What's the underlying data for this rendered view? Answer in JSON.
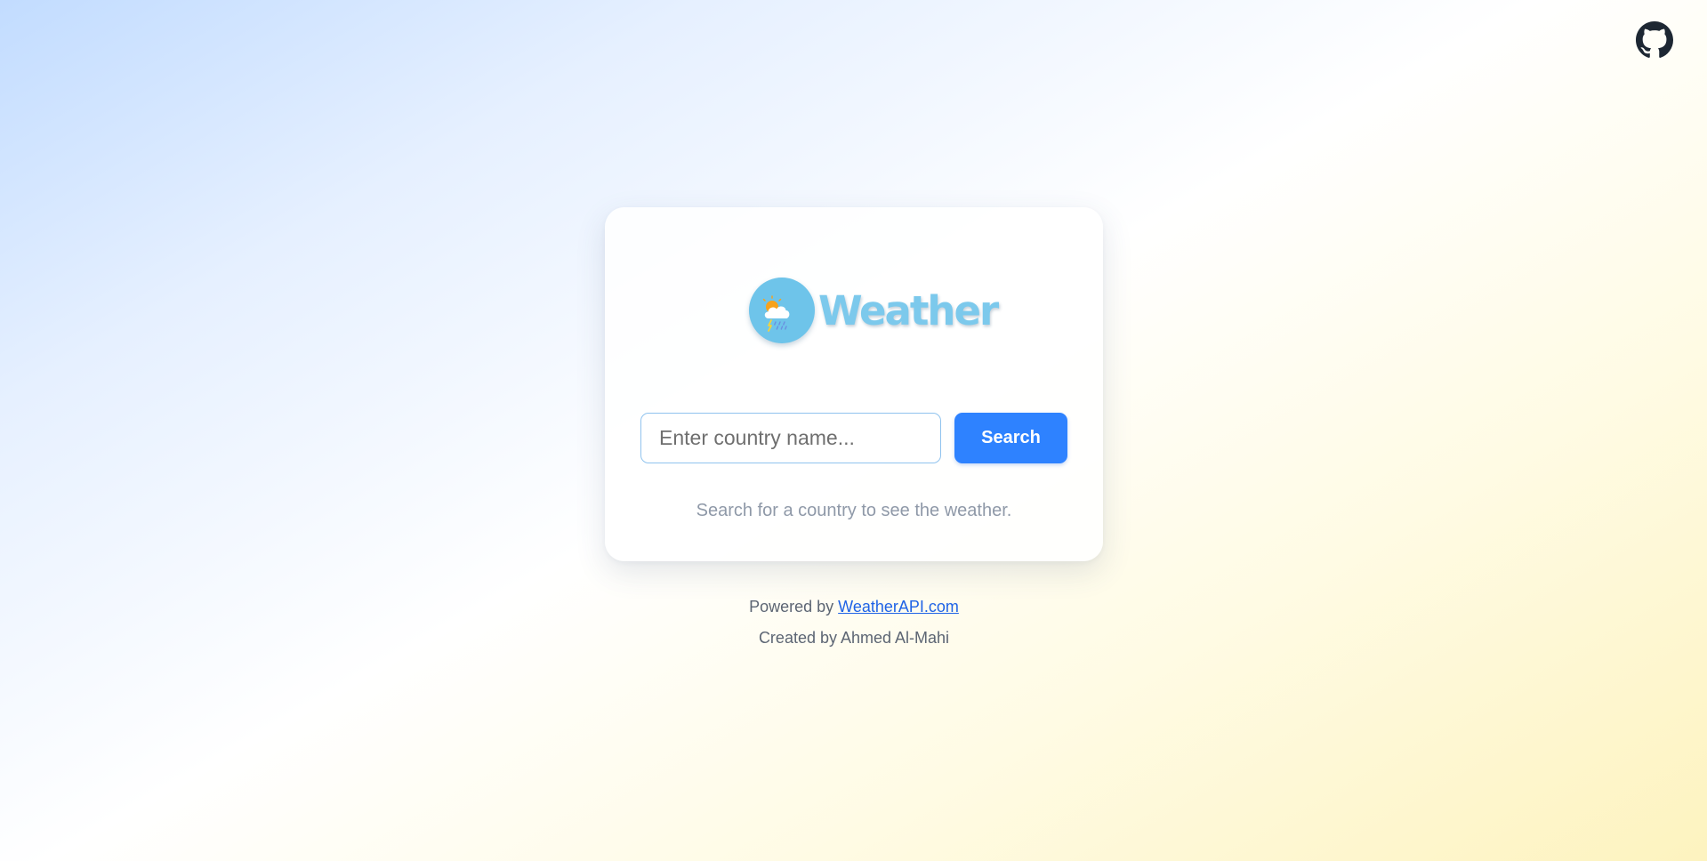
{
  "header": {
    "github_icon": "github-icon"
  },
  "card": {
    "logo": {
      "icon": "cloud-sun-rain-icon",
      "text": "Weather",
      "badge_color": "#6ec4ea",
      "text_color": "#7cc9ec"
    },
    "search": {
      "placeholder": "Enter country name...",
      "value": "",
      "button_label": "Search",
      "button_color": "#2e82ff"
    },
    "hint": "Search for a country to see the weather."
  },
  "footer": {
    "powered_prefix": "Powered by ",
    "powered_link": "WeatherAPI.com",
    "created": "Created by Ahmed Al-Mahi",
    "link_color": "#1f63e6"
  }
}
